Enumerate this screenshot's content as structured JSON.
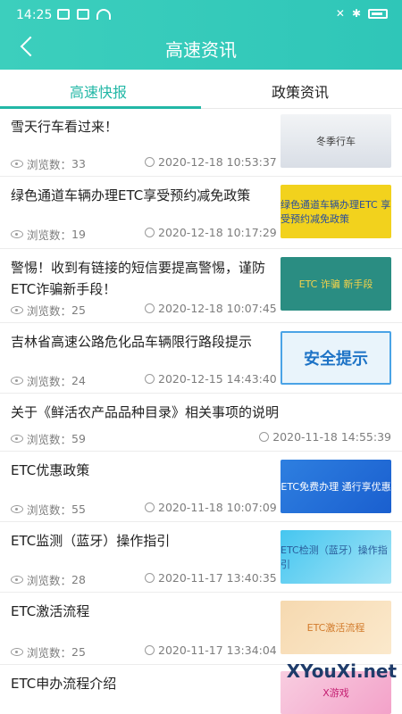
{
  "statusbar": {
    "time": "14:25"
  },
  "header": {
    "title": "高速资讯"
  },
  "tabs": [
    {
      "label": "高速快报"
    },
    {
      "label": "政策资讯"
    }
  ],
  "meta": {
    "views_label": "浏览数："
  },
  "items": [
    {
      "title": "雪天行车看过来！",
      "views": "33",
      "time": "2020-12-18 10:53:37",
      "thumb_text": "冬季行车"
    },
    {
      "title": "绿色通道车辆办理ETC享受预约减免政策",
      "views": "19",
      "time": "2020-12-18 10:17:29",
      "thumb_text": "绿色通道车辆办理ETC 享受预约减免政策"
    },
    {
      "title": "警惕！收到有链接的短信要提高警惕，谨防ETC诈骗新手段！",
      "views": "25",
      "time": "2020-12-18 10:07:45",
      "thumb_text": "ETC 诈骗 新手段"
    },
    {
      "title": "吉林省高速公路危化品车辆限行路段提示",
      "views": "24",
      "time": "2020-12-15 14:43:40",
      "thumb_text": "安全提示"
    },
    {
      "title": "关于《鲜活农产品品种目录》相关事项的说明",
      "views": "59",
      "time": "2020-11-18 14:55:39"
    },
    {
      "title": "ETC优惠政策",
      "views": "55",
      "time": "2020-11-18 10:07:09",
      "thumb_text": "ETC免费办理 通行享优惠"
    },
    {
      "title": "ETC监测（蓝牙）操作指引",
      "views": "28",
      "time": "2020-11-17 13:40:35",
      "thumb_text": "ETC检测（蓝牙）操作指引"
    },
    {
      "title": "ETC激活流程",
      "views": "25",
      "time": "2020-11-17 13:34:04",
      "thumb_text": "ETC激活流程"
    },
    {
      "title": "ETC申办流程介绍",
      "thumb_text": "X游戏"
    }
  ],
  "watermark": {
    "text": "XYouXi.net",
    "small": "X游戏"
  }
}
